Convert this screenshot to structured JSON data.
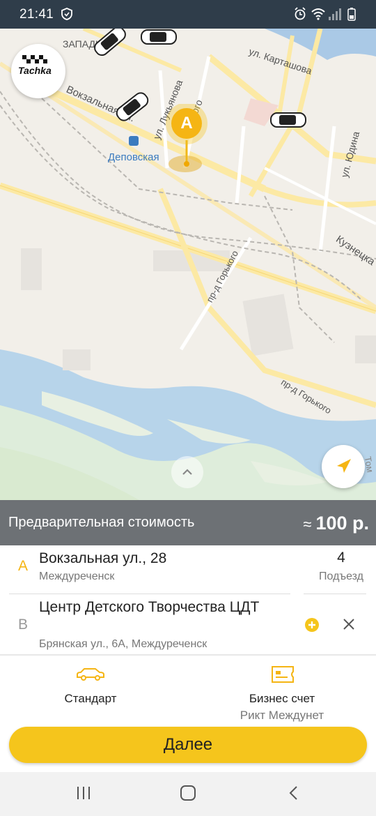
{
  "status_bar": {
    "time": "21:41"
  },
  "map": {
    "streets": {
      "zapadnaya": "ЗАПАДН",
      "kartashova": "ул. Карташова",
      "vokzalnaya": "Вокзальная ул.",
      "lukyanova": "ул. Лукьянова",
      "inskogo": "инского",
      "yudina": "ул. Юдина",
      "kuznetska": "Кузнецка",
      "gorkogo_1": "пр-д Горького",
      "gorkogo_2": "пр-д Горького",
      "tom": "Том"
    },
    "station": "Деповская",
    "pin_letter": "A",
    "logo_text": "Tachka"
  },
  "price": {
    "label": "Предварительная стоимость",
    "approx": "≈",
    "value": "100 р."
  },
  "route": {
    "from": {
      "letter": "A",
      "title": "Вокзальная ул., 28",
      "subtitle": "Междуреченск",
      "entrance_number": "4",
      "entrance_label": "Подъезд"
    },
    "to": {
      "letter": "B",
      "title": "Центр Детского Творчества ЦДТ",
      "subtitle": "Брянская ул., 6А, Междуреченск"
    }
  },
  "tariffs": [
    {
      "label": "Стандарт",
      "icon": "car-icon"
    },
    {
      "label": "Бизнес счет",
      "sub": "Рикт Междунет",
      "icon": "ticket-icon"
    }
  ],
  "next_button": "Далее",
  "colors": {
    "accent": "#f5c51c",
    "status_bar": "#2f3d4a",
    "price_bar": "#6d7175"
  }
}
